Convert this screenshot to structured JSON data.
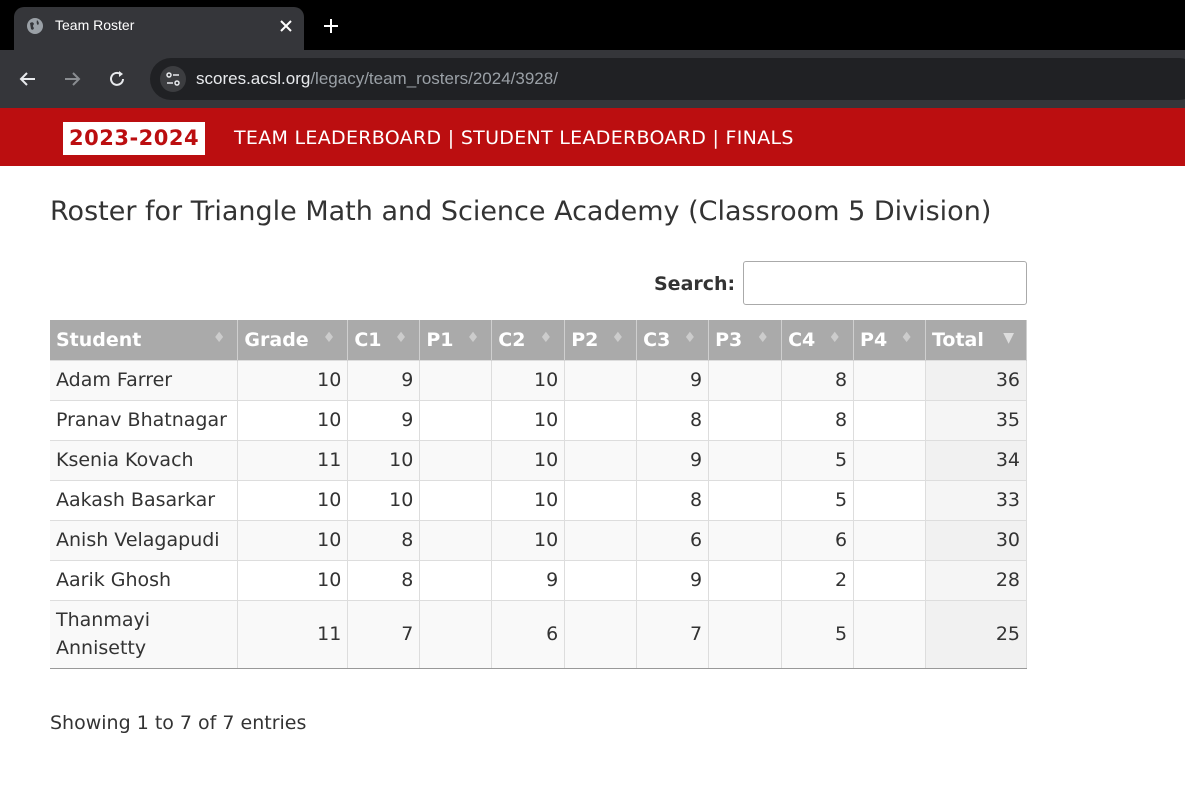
{
  "browser": {
    "tab_title": "Team Roster",
    "url_host": "scores.acsl.org",
    "url_path": "/legacy/team_rosters/2024/3928/"
  },
  "banner": {
    "year": "2023-2024",
    "links": [
      "TEAM LEADERBOARD",
      "STUDENT LEADERBOARD",
      "FINALS"
    ],
    "separator": " | "
  },
  "page": {
    "title": "Roster for Triangle Math and Science Academy (Classroom 5 Division)",
    "search_label": "Search:",
    "search_value": "",
    "info": "Showing 1 to 7 of 7 entries"
  },
  "table": {
    "columns": [
      "Student",
      "Grade",
      "C1",
      "P1",
      "C2",
      "P2",
      "C3",
      "P3",
      "C4",
      "P4",
      "Total"
    ],
    "rows": [
      [
        "Adam Farrer",
        "10",
        "9",
        "",
        "10",
        "",
        "9",
        "",
        "8",
        "",
        "36"
      ],
      [
        "Pranav Bhatnagar",
        "10",
        "9",
        "",
        "10",
        "",
        "8",
        "",
        "8",
        "",
        "35"
      ],
      [
        "Ksenia Kovach",
        "11",
        "10",
        "",
        "10",
        "",
        "9",
        "",
        "5",
        "",
        "34"
      ],
      [
        "Aakash Basarkar",
        "10",
        "10",
        "",
        "10",
        "",
        "8",
        "",
        "5",
        "",
        "33"
      ],
      [
        "Anish Velagapudi",
        "10",
        "8",
        "",
        "10",
        "",
        "6",
        "",
        "6",
        "",
        "30"
      ],
      [
        "Aarik Ghosh",
        "10",
        "8",
        "",
        "9",
        "",
        "9",
        "",
        "2",
        "",
        "28"
      ],
      [
        "Thanmayi Annisetty",
        "11",
        "7",
        "",
        "6",
        "",
        "7",
        "",
        "5",
        "",
        "25"
      ]
    ]
  },
  "icons": {
    "favicon": "globe-icon",
    "close": "close-icon",
    "new_tab": "plus-icon",
    "back": "arrow-left-icon",
    "forward": "arrow-right-icon",
    "reload": "reload-icon",
    "site_info": "tune-icon",
    "sort": "sort-both-icon",
    "sort_desc": "sort-desc-icon"
  },
  "colors": {
    "banner_red": "#bb0e10",
    "header_gray": "#aaaaaa"
  }
}
